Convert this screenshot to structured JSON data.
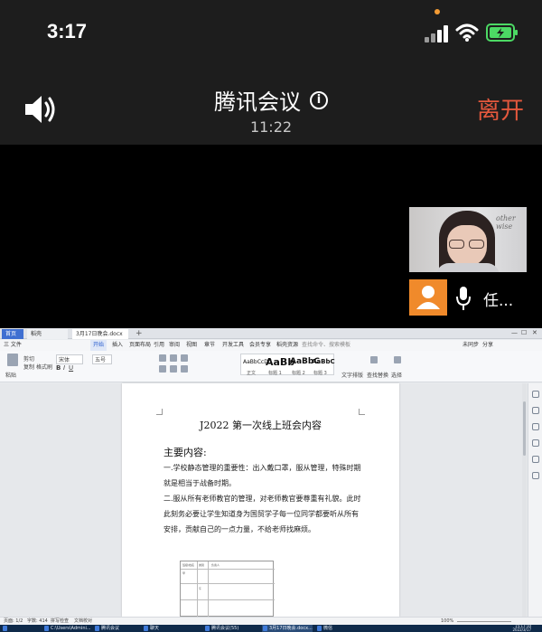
{
  "status_bar": {
    "time": "3:17",
    "battery_color": "#4cd964"
  },
  "meeting": {
    "title": "腾讯会议",
    "info_icon": "i",
    "elapsed": "11:22",
    "leave_label": "离开",
    "leave_color": "#e4583d"
  },
  "participant": {
    "name": "任...",
    "avatar_color": "#f08a2b",
    "wall_text": "other wise"
  },
  "shared_screen": {
    "tabs": [
      {
        "label": "首页"
      },
      {
        "label": "稻壳"
      },
      {
        "label": "3月17日晚会.docx"
      },
      {
        "label": "+"
      }
    ],
    "menu": [
      {
        "label": "三 文件"
      },
      {
        "label": "开始"
      },
      {
        "label": "插入"
      },
      {
        "label": "页面布局"
      },
      {
        "label": "引用"
      },
      {
        "label": "审阅"
      },
      {
        "label": "视图"
      },
      {
        "label": "章节"
      },
      {
        "label": "开发工具"
      },
      {
        "label": "会员专享"
      },
      {
        "label": "稻壳资源"
      },
      {
        "label": "查找命令、搜索模板"
      }
    ],
    "menu_right": {
      "cloud": "未同步",
      "share": "分享"
    },
    "ribbon": {
      "clipboard": [
        "剪切",
        "复制",
        "格式刷"
      ],
      "paste": "粘贴",
      "font_name": "宋体",
      "font_size": "五号",
      "styles": [
        {
          "sample": "AaBbCcDd",
          "label": "正文"
        },
        {
          "sample": "AaBb",
          "label": "标题 1"
        },
        {
          "sample": "AaBbC",
          "label": "标题 2"
        },
        {
          "sample": "AaBbC",
          "label": "标题 3"
        }
      ],
      "text_tools": "文字排版",
      "find_replace": "查找替换",
      "select": "选择"
    },
    "document": {
      "title": "J2022 第一次线上班会内容",
      "subtitle": "主要内容:",
      "paragraphs": [
        "一.学校静态管理的重要性：出入戴口罩，服从管理，特殊时期就是相当于战备时期。",
        "二.服从所有老师教官的管理，对老师教官要尊重有礼貌。此时此刻务必要让学生知道身为国贸学子每一位同学都要听从所有安排，贡献自己的一点力量，不给老师找麻烦。"
      ],
      "table_cells": [
        "班级/姓名",
        "类别",
        "负责人",
        "早",
        "午"
      ]
    },
    "status": {
      "page": "页面: 1/2",
      "words": "字数: 414",
      "spell": "拼写检查",
      "doc_check": "文档校对",
      "zoom": "100%"
    },
    "taskbar": [
      {
        "label": "C:\\Users\\Admini..."
      },
      {
        "label": "腾讯会议"
      },
      {
        "label": "聊天"
      },
      {
        "label": "腾讯会议(55)"
      },
      {
        "label": "3月17日晚会.docx..."
      },
      {
        "label": "微信"
      }
    ],
    "tray_time": "15:17:10",
    "tray_date": "2022/3/17"
  }
}
